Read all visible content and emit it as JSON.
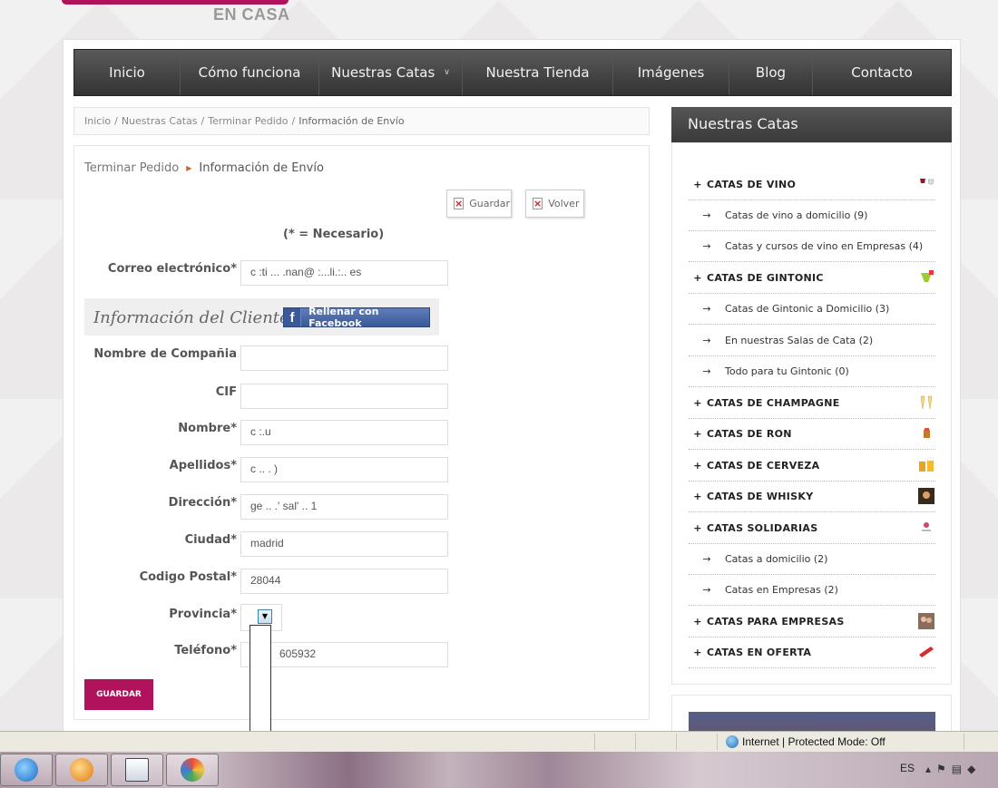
{
  "logo": {
    "sub": "EN CASA"
  },
  "nav": {
    "items": [
      {
        "label": "Inicio"
      },
      {
        "label": "Cómo funciona"
      },
      {
        "label": "Nuestras Catas"
      },
      {
        "label": "Nuestra Tienda"
      },
      {
        "label": "Imágenes"
      },
      {
        "label": "Blog"
      },
      {
        "label": "Contacto"
      }
    ]
  },
  "breadcrumb": {
    "items": [
      "Inicio",
      "Nuestras Catas",
      "Terminar Pedido"
    ],
    "separator": "/",
    "current": "Información de Envío"
  },
  "steps": {
    "previous": "Terminar Pedido",
    "current": "Información de Envío"
  },
  "toolbar": {
    "save_label": "Guardar",
    "back_label": "Volver"
  },
  "required_note": "(* = Necesario)",
  "form": {
    "email_label": "Correo electrónico*",
    "email_value": "c  :ti  ...  .nan@ :...li.:.. es",
    "client_section_title": "Información del Cliente",
    "facebook_button": "Rellenar con Facebook",
    "company_label": "Nombre de Compañia",
    "company_value": "",
    "cif_label": "CIF",
    "cif_value": "",
    "name_label": "Nombre*",
    "name_value": "c :.u",
    "surname_label": "Apellidos*",
    "surname_value": "c .. .  )",
    "address_label": "Dirección*",
    "address_value": "ge .. .' sal'  ..    1",
    "city_label": "Ciudad*",
    "city_value": "madrid",
    "postal_label": "Codigo Postal*",
    "postal_value": "28044",
    "province_label": "Provincia*",
    "phone_label": "Teléfono*",
    "phone_value": "605932",
    "submit_label": "GUARDAR"
  },
  "sidebar": {
    "title": "Nuestras Catas",
    "categories": [
      {
        "label": "CATAS DE VINO",
        "type": "main",
        "icon": "wine-glass-icon"
      },
      {
        "label": "Catas de vino a domicilio (9)",
        "type": "sub"
      },
      {
        "label": "Catas y cursos de vino en Empresas (4)",
        "type": "sub"
      },
      {
        "label": "CATAS DE GINTONIC",
        "type": "main",
        "icon": "cocktail-icon"
      },
      {
        "label": "Catas de Gintonic a Domicilio (3)",
        "type": "sub"
      },
      {
        "label": "En nuestras Salas de Cata (2)",
        "type": "sub"
      },
      {
        "label": "Todo para tu Gintonic (0)",
        "type": "sub"
      },
      {
        "label": "CATAS DE CHAMPAGNE",
        "type": "main",
        "icon": "champagne-icon"
      },
      {
        "label": "CATAS DE RON",
        "type": "main",
        "icon": "rum-glass-icon"
      },
      {
        "label": "CATAS DE CERVEZA",
        "type": "main",
        "icon": "beer-icon"
      },
      {
        "label": "CATAS DE WHISKY",
        "type": "main",
        "icon": "whisky-icon"
      },
      {
        "label": "CATAS SOLIDARIAS",
        "type": "main",
        "icon": "solidarity-icon"
      },
      {
        "label": "Catas a domicilio (2)",
        "type": "sub"
      },
      {
        "label": "Catas en Empresas (2)",
        "type": "sub"
      },
      {
        "label": "CATAS PARA EMPRESAS",
        "type": "main",
        "icon": "business-photo-icon"
      },
      {
        "label": "CATAS EN OFERTA",
        "type": "main",
        "icon": "offer-tag-icon"
      }
    ]
  },
  "statusbar": {
    "zone": "Internet | Protected Mode: Off"
  },
  "taskbar": {
    "language": "ES"
  },
  "colors": {
    "brand": "#b0125b",
    "nav_dark": "#3a3a3a",
    "facebook": "#3b5998"
  }
}
